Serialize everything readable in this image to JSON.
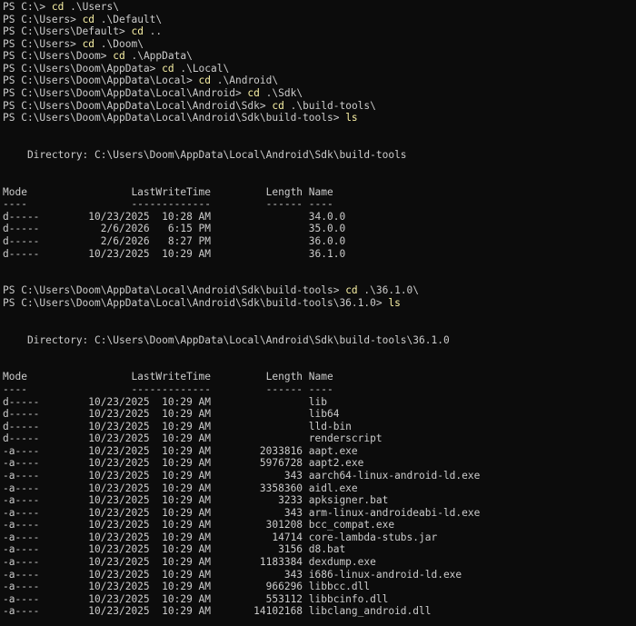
{
  "lines": [
    {
      "type": "cmd",
      "prompt": "PS C:\\> ",
      "cmd": "cd",
      "args": " .\\Users\\"
    },
    {
      "type": "cmd",
      "prompt": "PS C:\\Users> ",
      "cmd": "cd",
      "args": " .\\Default\\"
    },
    {
      "type": "cmd",
      "prompt": "PS C:\\Users\\Default> ",
      "cmd": "cd",
      "args": " .."
    },
    {
      "type": "cmd",
      "prompt": "PS C:\\Users> ",
      "cmd": "cd",
      "args": " .\\Doom\\"
    },
    {
      "type": "cmd",
      "prompt": "PS C:\\Users\\Doom> ",
      "cmd": "cd",
      "args": " .\\AppData\\"
    },
    {
      "type": "cmd",
      "prompt": "PS C:\\Users\\Doom\\AppData> ",
      "cmd": "cd",
      "args": " .\\Local\\"
    },
    {
      "type": "cmd",
      "prompt": "PS C:\\Users\\Doom\\AppData\\Local> ",
      "cmd": "cd",
      "args": " .\\Android\\"
    },
    {
      "type": "cmd",
      "prompt": "PS C:\\Users\\Doom\\AppData\\Local\\Android> ",
      "cmd": "cd",
      "args": " .\\Sdk\\"
    },
    {
      "type": "cmd",
      "prompt": "PS C:\\Users\\Doom\\AppData\\Local\\Android\\Sdk> ",
      "cmd": "cd",
      "args": " .\\build-tools\\"
    },
    {
      "type": "cmd",
      "prompt": "PS C:\\Users\\Doom\\AppData\\Local\\Android\\Sdk\\build-tools> ",
      "cmd": "ls",
      "args": ""
    },
    {
      "type": "text",
      "text": ""
    },
    {
      "type": "text",
      "text": ""
    },
    {
      "type": "text",
      "text": "    Directory: C:\\Users\\Doom\\AppData\\Local\\Android\\Sdk\\build-tools"
    },
    {
      "type": "text",
      "text": ""
    },
    {
      "type": "text",
      "text": ""
    },
    {
      "type": "text",
      "text": "Mode                 LastWriteTime         Length Name"
    },
    {
      "type": "text",
      "text": "----                 -------------         ------ ----"
    },
    {
      "type": "text",
      "text": "d-----        10/23/2025  10:28 AM                34.0.0"
    },
    {
      "type": "text",
      "text": "d-----          2/6/2026   6:15 PM                35.0.0"
    },
    {
      "type": "text",
      "text": "d-----          2/6/2026   8:27 PM                36.0.0"
    },
    {
      "type": "text",
      "text": "d-----        10/23/2025  10:29 AM                36.1.0"
    },
    {
      "type": "text",
      "text": ""
    },
    {
      "type": "text",
      "text": ""
    },
    {
      "type": "cmd",
      "prompt": "PS C:\\Users\\Doom\\AppData\\Local\\Android\\Sdk\\build-tools> ",
      "cmd": "cd",
      "args": " .\\36.1.0\\"
    },
    {
      "type": "cmd",
      "prompt": "PS C:\\Users\\Doom\\AppData\\Local\\Android\\Sdk\\build-tools\\36.1.0> ",
      "cmd": "ls",
      "args": ""
    },
    {
      "type": "text",
      "text": ""
    },
    {
      "type": "text",
      "text": ""
    },
    {
      "type": "text",
      "text": "    Directory: C:\\Users\\Doom\\AppData\\Local\\Android\\Sdk\\build-tools\\36.1.0"
    },
    {
      "type": "text",
      "text": ""
    },
    {
      "type": "text",
      "text": ""
    },
    {
      "type": "text",
      "text": "Mode                 LastWriteTime         Length Name"
    },
    {
      "type": "text",
      "text": "----                 -------------         ------ ----"
    },
    {
      "type": "text",
      "text": "d-----        10/23/2025  10:29 AM                lib"
    },
    {
      "type": "text",
      "text": "d-----        10/23/2025  10:29 AM                lib64"
    },
    {
      "type": "text",
      "text": "d-----        10/23/2025  10:29 AM                lld-bin"
    },
    {
      "type": "text",
      "text": "d-----        10/23/2025  10:29 AM                renderscript"
    },
    {
      "type": "text",
      "text": "-a----        10/23/2025  10:29 AM        2033816 aapt.exe"
    },
    {
      "type": "text",
      "text": "-a----        10/23/2025  10:29 AM        5976728 aapt2.exe"
    },
    {
      "type": "text",
      "text": "-a----        10/23/2025  10:29 AM            343 aarch64-linux-android-ld.exe"
    },
    {
      "type": "text",
      "text": "-a----        10/23/2025  10:29 AM        3358360 aidl.exe"
    },
    {
      "type": "text",
      "text": "-a----        10/23/2025  10:29 AM           3233 apksigner.bat"
    },
    {
      "type": "text",
      "text": "-a----        10/23/2025  10:29 AM            343 arm-linux-androideabi-ld.exe"
    },
    {
      "type": "text",
      "text": "-a----        10/23/2025  10:29 AM         301208 bcc_compat.exe"
    },
    {
      "type": "text",
      "text": "-a----        10/23/2025  10:29 AM          14714 core-lambda-stubs.jar"
    },
    {
      "type": "text",
      "text": "-a----        10/23/2025  10:29 AM           3156 d8.bat"
    },
    {
      "type": "text",
      "text": "-a----        10/23/2025  10:29 AM        1183384 dexdump.exe"
    },
    {
      "type": "text",
      "text": "-a----        10/23/2025  10:29 AM            343 i686-linux-android-ld.exe"
    },
    {
      "type": "text",
      "text": "-a----        10/23/2025  10:29 AM         966296 libbcc.dll"
    },
    {
      "type": "text",
      "text": "-a----        10/23/2025  10:29 AM         553112 libbcinfo.dll"
    },
    {
      "type": "text",
      "text": "-a----        10/23/2025  10:29 AM       14102168 libclang_android.dll"
    }
  ],
  "colors": {
    "background": "#0c0c0c",
    "text": "#cccccc",
    "command": "#f9f1a5"
  }
}
